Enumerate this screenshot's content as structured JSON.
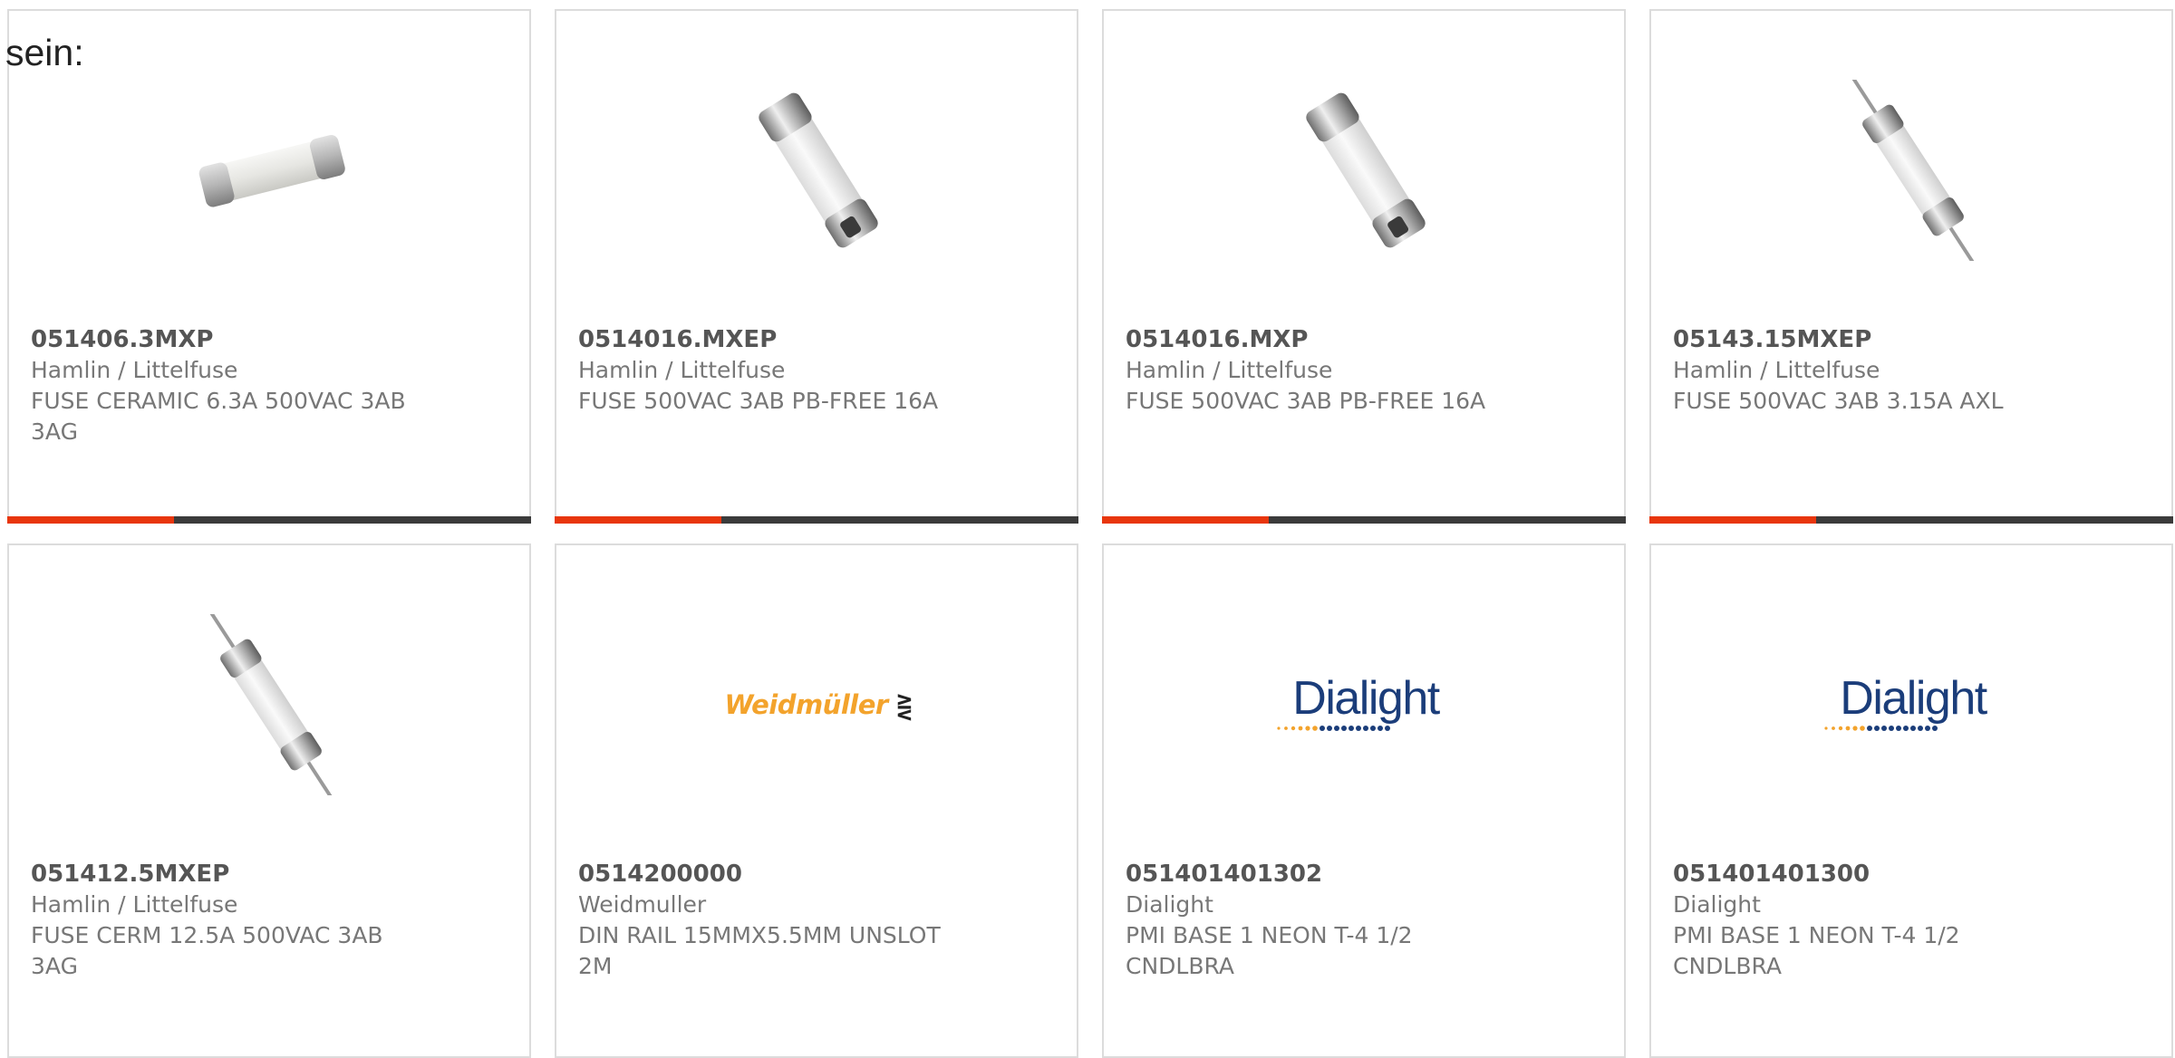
{
  "prefix_text": "sein:",
  "colors": {
    "accent": "#e8360c",
    "bar": "#3b3b3b",
    "border": "#dcdcdc"
  },
  "products": [
    {
      "part_number": "051406.3MXP",
      "manufacturer": "Hamlin / Littelfuse",
      "description": "FUSE CERAMIC 6.3A 500VAC 3AB 3AG",
      "image": "fuse-short-icon"
    },
    {
      "part_number": "0514016.MXEP",
      "manufacturer": "Hamlin / Littelfuse",
      "description": "FUSE 500VAC 3AB PB-FREE 16A",
      "image": "fuse-diagonal-icon"
    },
    {
      "part_number": "0514016.MXP",
      "manufacturer": "Hamlin / Littelfuse",
      "description": "FUSE 500VAC 3AB PB-FREE 16A",
      "image": "fuse-diagonal-icon"
    },
    {
      "part_number": "05143.15MXEP",
      "manufacturer": "Hamlin / Littelfuse",
      "description": "FUSE 500VAC 3AB 3.15A AXL",
      "image": "fuse-axial-icon"
    },
    {
      "part_number": "051412.5MXEP",
      "manufacturer": "Hamlin / Littelfuse",
      "description": "FUSE CERM 12.5A 500VAC 3AB 3AG",
      "image": "fuse-axial-icon"
    },
    {
      "part_number": "0514200000",
      "manufacturer": "Weidmuller",
      "description": "DIN RAIL 15MMX5.5MM UNSLOT 2M",
      "image": "weidmuller-logo",
      "logo_text": "Weidmüller"
    },
    {
      "part_number": "051401401302",
      "manufacturer": "Dialight",
      "description": "PMI BASE 1 NEON T-4 1/2 CNDLBRA",
      "image": "dialight-logo",
      "logo_text": "Dialight"
    },
    {
      "part_number": "051401401300",
      "manufacturer": "Dialight",
      "description": "PMI BASE 1 NEON T-4 1/2 CNDLBRA",
      "image": "dialight-logo",
      "logo_text": "Dialight"
    }
  ]
}
